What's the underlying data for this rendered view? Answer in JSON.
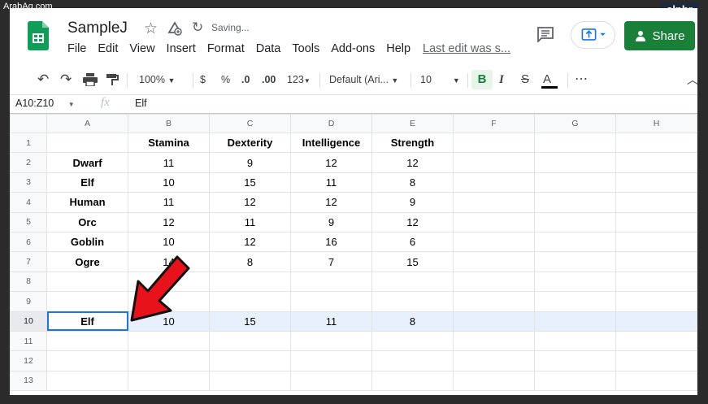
{
  "watermark": "ArabAq.com",
  "brand": "alphr",
  "doc": {
    "title": "SampleJ",
    "status": "Saving..."
  },
  "menu": [
    "File",
    "Edit",
    "View",
    "Insert",
    "Format",
    "Data",
    "Tools",
    "Add-ons",
    "Help"
  ],
  "last_edit": "Last edit was s...",
  "share_label": "Share",
  "toolbar": {
    "zoom": "100%",
    "currency": "$",
    "percent": "%",
    "dec_decrease": ".0",
    "dec_increase": ".00",
    "format_more": "123",
    "font": "Default (Ari...",
    "font_size": "10",
    "bold": "B",
    "italic": "I",
    "strike": "S",
    "text_color": "A",
    "more": "⋯"
  },
  "formula_bar": {
    "name_box": "A10:Z10",
    "fx": "fx",
    "value": "Elf"
  },
  "columns": [
    "A",
    "B",
    "C",
    "D",
    "E",
    "F",
    "G",
    "H"
  ],
  "rows": [
    {
      "num": "1",
      "cells": [
        "",
        "Stamina",
        "Dexterity",
        "Intelligence",
        "Strength",
        "",
        "",
        ""
      ]
    },
    {
      "num": "2",
      "cells": [
        "Dwarf",
        "11",
        "9",
        "12",
        "12",
        "",
        "",
        ""
      ]
    },
    {
      "num": "3",
      "cells": [
        "Elf",
        "10",
        "15",
        "11",
        "8",
        "",
        "",
        ""
      ]
    },
    {
      "num": "4",
      "cells": [
        "Human",
        "11",
        "12",
        "12",
        "9",
        "",
        "",
        ""
      ]
    },
    {
      "num": "5",
      "cells": [
        "Orc",
        "12",
        "11",
        "9",
        "12",
        "",
        "",
        ""
      ]
    },
    {
      "num": "6",
      "cells": [
        "Goblin",
        "10",
        "12",
        "16",
        "6",
        "",
        "",
        ""
      ]
    },
    {
      "num": "7",
      "cells": [
        "Ogre",
        "14",
        "8",
        "7",
        "15",
        "",
        "",
        ""
      ]
    },
    {
      "num": "8",
      "cells": [
        "",
        "",
        "",
        "",
        "",
        "",
        "",
        ""
      ]
    },
    {
      "num": "9",
      "cells": [
        "",
        "",
        "",
        "",
        "",
        "",
        "",
        ""
      ]
    },
    {
      "num": "10",
      "cells": [
        "Elf",
        "10",
        "15",
        "11",
        "8",
        "",
        "",
        ""
      ]
    },
    {
      "num": "11",
      "cells": [
        "",
        "",
        "",
        "",
        "",
        "",
        "",
        ""
      ]
    },
    {
      "num": "12",
      "cells": [
        "",
        "",
        "",
        "",
        "",
        "",
        "",
        ""
      ]
    },
    {
      "num": "13",
      "cells": [
        "",
        "",
        "",
        "",
        "",
        "",
        "",
        ""
      ]
    }
  ],
  "colors": {
    "accent": "#1a73e8",
    "share": "#188038",
    "selection": "#e8f0fe",
    "arrow": "#e8131a"
  }
}
